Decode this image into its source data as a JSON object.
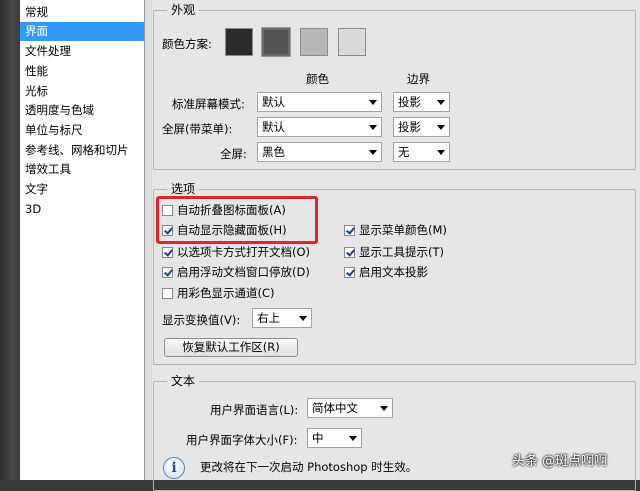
{
  "sidebar": {
    "items": [
      {
        "label": "常规"
      },
      {
        "label": "界面",
        "selected": true
      },
      {
        "label": "文件处理"
      },
      {
        "label": "性能"
      },
      {
        "label": "光标"
      },
      {
        "label": "透明度与色域"
      },
      {
        "label": "单位与标尺"
      },
      {
        "label": "参考线、网格和切片"
      },
      {
        "label": "增效工具"
      },
      {
        "label": "文字"
      },
      {
        "label": "3D"
      }
    ]
  },
  "appearance": {
    "legend": "外观",
    "color_scheme_label": "颜色方案:",
    "swatches": [
      {
        "color": "#2b2b2b"
      },
      {
        "color": "#535353",
        "selected": true
      },
      {
        "color": "#b8b8b8"
      },
      {
        "color": "#d9d9d9"
      }
    ],
    "col_color": "颜色",
    "col_border": "边界",
    "rows": [
      {
        "label": "标准屏幕模式:",
        "color": "默认",
        "border": "投影"
      },
      {
        "label": "全屏(带菜单):",
        "color": "默认",
        "border": "投影"
      },
      {
        "label": "全屏:",
        "color": "黑色",
        "border": "无"
      }
    ]
  },
  "options": {
    "legend": "选项",
    "checkboxes": [
      {
        "label": "自动折叠图标面板(A)",
        "checked": false
      },
      {
        "label": "自动显示隐藏面板(H)",
        "checked": true
      },
      {
        "label": "以选项卡方式打开文档(O)",
        "checked": true
      },
      {
        "label": "启用浮动文档窗口停放(D)",
        "checked": true
      },
      {
        "label": "用彩色显示通道(C)",
        "checked": false
      },
      {
        "label": "显示菜单颜色(M)",
        "checked": true
      },
      {
        "label": "显示工具提示(T)",
        "checked": true
      },
      {
        "label": "启用文本投影",
        "checked": true
      }
    ],
    "transform_label": "显示变换值(V):",
    "transform_value": "右上",
    "reset_button": "恢复默认工作区(R)"
  },
  "text": {
    "legend": "文本",
    "language_label": "用户界面语言(L):",
    "language_value": "简体中文",
    "fontsize_label": "用户界面字体大小(F):",
    "fontsize_value": "中",
    "notice": "更改将在下一次启动 Photoshop 时生效。"
  },
  "watermark": "头条 @斑点啊啊",
  "colors": {
    "highlight": "#3399ff",
    "annotation_red": "#e0242b"
  }
}
